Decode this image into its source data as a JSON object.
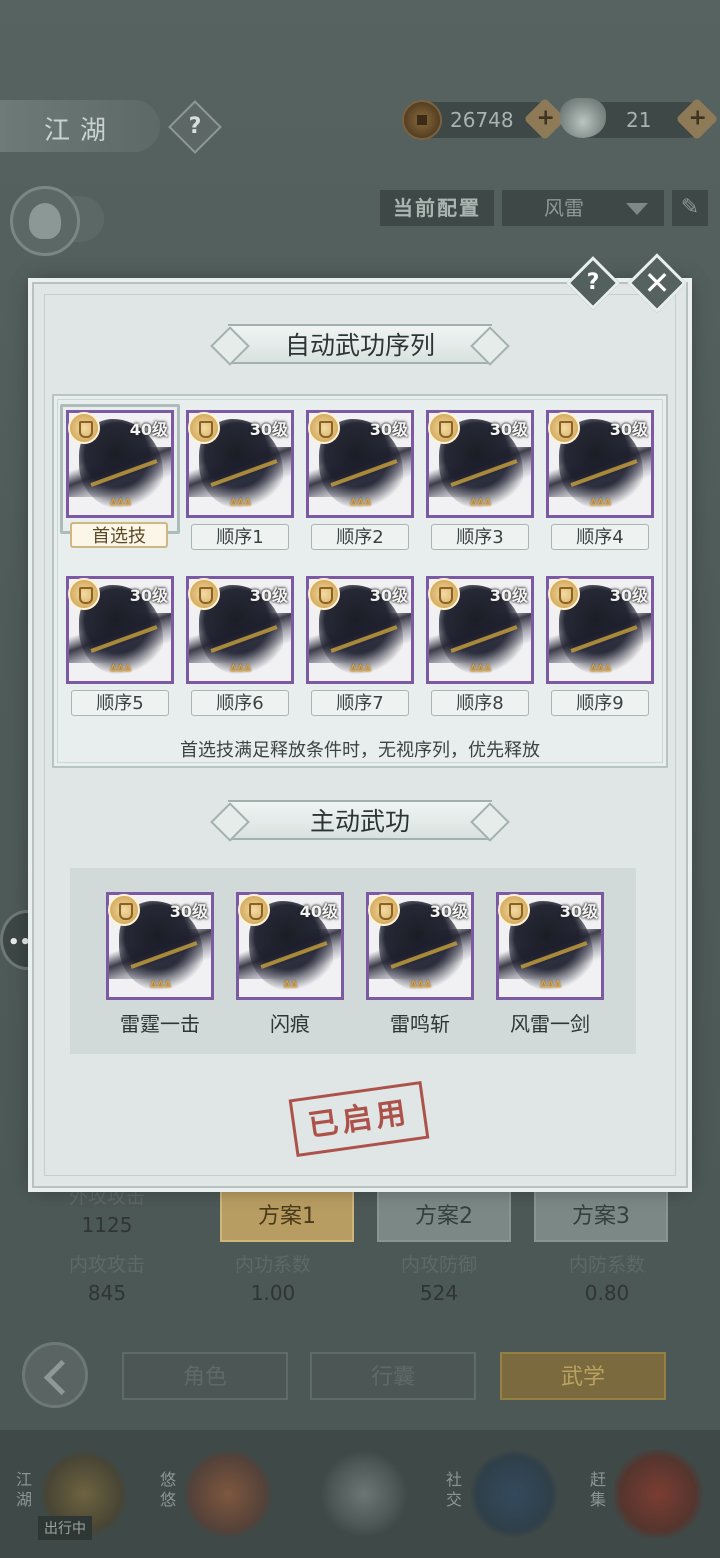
{
  "header": {
    "title": "江湖",
    "help_label": "?",
    "copper_amount": "26748",
    "silver_amount": "21",
    "plus_label": "+"
  },
  "config": {
    "label": "当前配置",
    "selected": "风雷",
    "edit_icon": "✎"
  },
  "stats": [
    {
      "label": "外攻攻击",
      "value": "1125"
    },
    {
      "label": "内攻攻击",
      "value": "845"
    },
    {
      "label": "内功系数",
      "value": "1.00"
    },
    {
      "label": "内攻防御",
      "value": "524"
    },
    {
      "label": "内防系数",
      "value": "0.80"
    }
  ],
  "plans": [
    "方案1",
    "方案2",
    "方案3"
  ],
  "nav": {
    "tabs": [
      "角色",
      "行囊",
      "武学"
    ]
  },
  "bottom_bar": {
    "items": [
      "江湖",
      "悠悠",
      "社交",
      "赶集"
    ],
    "tag": "出行中"
  },
  "modal": {
    "help_label": "?",
    "close_label": "✕",
    "auto_title": "自动武功序列",
    "auto_skills": [
      {
        "level": "40级",
        "tag": "首选技",
        "flames": "ᐞᐞᐞ"
      },
      {
        "level": "30级",
        "tag": "顺序1",
        "flames": "ᐞᐞᐞ"
      },
      {
        "level": "30级",
        "tag": "顺序2",
        "flames": "ᐞᐞᐞ"
      },
      {
        "level": "30级",
        "tag": "顺序3",
        "flames": "ᐞᐞᐞ"
      },
      {
        "level": "30级",
        "tag": "顺序4",
        "flames": "ᐞᐞᐞ"
      },
      {
        "level": "30级",
        "tag": "顺序5",
        "flames": "ᐞᐞᐞ"
      },
      {
        "level": "30级",
        "tag": "顺序6",
        "flames": "ᐞᐞᐞ"
      },
      {
        "level": "30级",
        "tag": "顺序7",
        "flames": "ᐞᐞᐞ"
      },
      {
        "level": "30级",
        "tag": "顺序8",
        "flames": "ᐞᐞᐞ"
      },
      {
        "level": "30级",
        "tag": "顺序9",
        "flames": "ᐞᐞᐞ"
      }
    ],
    "note": "首选技满足释放条件时，无视序列，优先释放",
    "active_title": "主动武功",
    "active_skills": [
      {
        "level": "30级",
        "name": "雷霆一击",
        "flames": "ᐞᐞᐞ"
      },
      {
        "level": "40级",
        "name": "闪痕",
        "flames": "ᐞᐞ"
      },
      {
        "level": "30级",
        "name": "雷鸣斩",
        "flames": "ᐞᐞᐞ"
      },
      {
        "level": "30级",
        "name": "风雷一剑",
        "flames": "ᐞᐞᐞ"
      }
    ],
    "stamp": "已启用"
  },
  "colors": {
    "card_border": "#7c5aa3",
    "stamp": "#a8423a",
    "gold": "#b89d62"
  }
}
